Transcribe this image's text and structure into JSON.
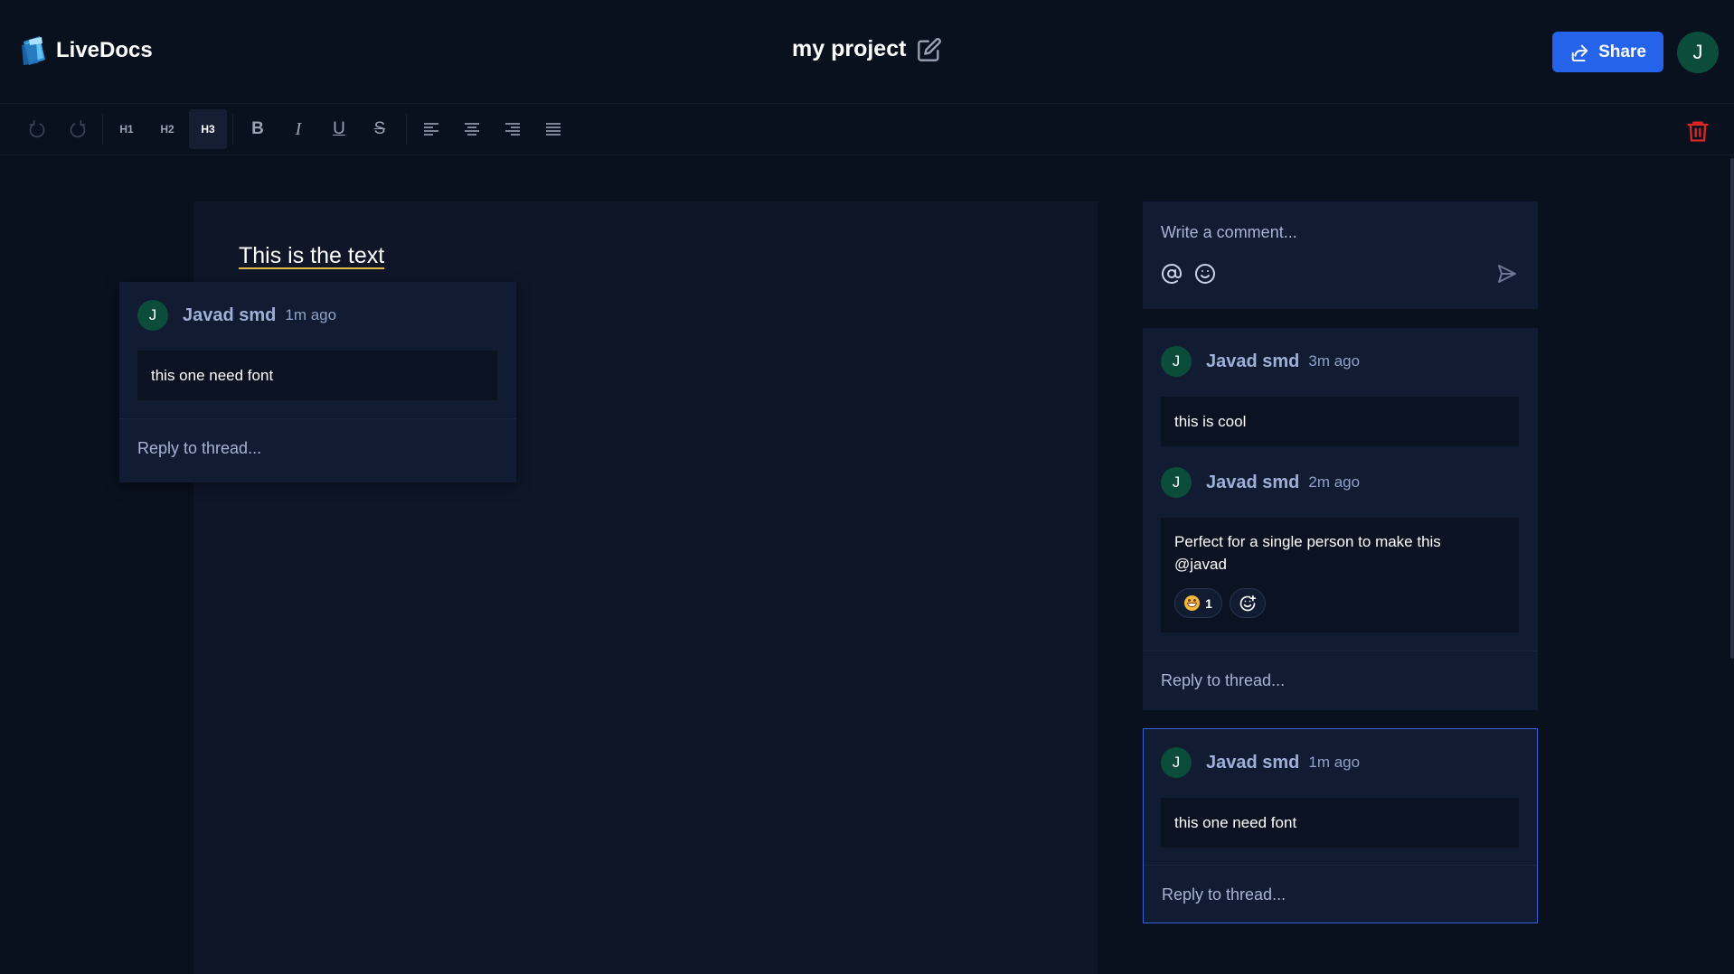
{
  "header": {
    "app_name": "LiveDocs",
    "doc_title": "my project",
    "share_label": "Share",
    "user_initial": "J"
  },
  "toolbar": {
    "h1": "H1",
    "h2": "H2",
    "h3": "H3",
    "active_heading": "H3"
  },
  "editor": {
    "text": "This is the text"
  },
  "floating_thread": {
    "author": "Javad smd",
    "time": "1m ago",
    "initial": "J",
    "body": "this one need font",
    "reply_placeholder": "Reply to thread..."
  },
  "composer": {
    "placeholder": "Write a comment..."
  },
  "threads": [
    {
      "comments": [
        {
          "author": "Javad smd",
          "time": "3m ago",
          "initial": "J",
          "body": "this is cool"
        },
        {
          "author": "Javad smd",
          "time": "2m ago",
          "initial": "J",
          "body": "Perfect for a single person to make this @javad",
          "reaction_count": "1"
        }
      ],
      "reply_placeholder": "Reply to thread..."
    },
    {
      "comments": [
        {
          "author": "Javad smd",
          "time": "1m ago",
          "initial": "J",
          "body": "this one need font"
        }
      ],
      "reply_placeholder": "Reply to thread..."
    }
  ],
  "colors": {
    "background": "#09111f",
    "accent": "#2563eb",
    "avatar": "#0b4d3a",
    "delete": "#dc2626"
  }
}
